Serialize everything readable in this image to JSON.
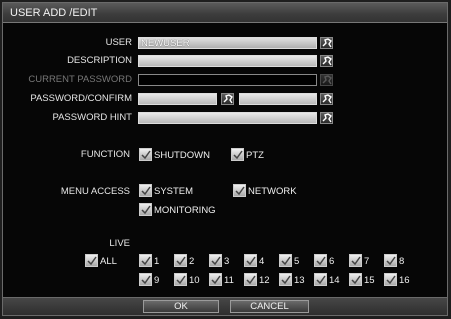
{
  "window": {
    "title": "USER ADD /EDIT"
  },
  "form": {
    "user_label": "USER",
    "user_value": "NEWUSER",
    "description_label": "DESCRIPTION",
    "current_password_label": "CURRENT PASSWORD",
    "password_confirm_label": "PASSWORD/CONFIRM",
    "password_hint_label": "PASSWORD HINT"
  },
  "function": {
    "label": "FUNCTION",
    "options": [
      {
        "label": "SHUTDOWN",
        "checked": true
      },
      {
        "label": "PTZ",
        "checked": true
      }
    ]
  },
  "menu_access": {
    "label": "MENU ACCESS",
    "options": [
      {
        "label": "SYSTEM",
        "checked": true
      },
      {
        "label": "NETWORK",
        "checked": true
      },
      {
        "label": "MONITORING",
        "checked": true
      }
    ]
  },
  "live": {
    "label": "LIVE",
    "all_label": "ALL",
    "channels": [
      "1",
      "2",
      "3",
      "4",
      "5",
      "6",
      "7",
      "8",
      "9",
      "10",
      "11",
      "12",
      "13",
      "14",
      "15",
      "16"
    ]
  },
  "buttons": {
    "ok": "OK",
    "cancel": "CANCEL"
  },
  "icons": {
    "keyboard": "keyboard-icon",
    "check": "check-icon"
  },
  "colors": {
    "background": "#060606",
    "field": "#c8c8c8",
    "titlebar": "#3c3c3c",
    "text": "#e6e6e6"
  }
}
